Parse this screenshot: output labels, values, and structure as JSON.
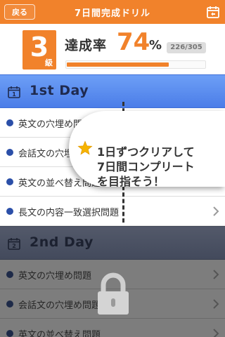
{
  "topbar": {
    "back_label": "戻る",
    "title": "7日間完成ドリル",
    "reset_icon": "calendar-reset-icon"
  },
  "progress": {
    "level_number": "3",
    "level_unit": "級",
    "rate_label": "達成率",
    "rate_value": "74",
    "rate_unit": "%",
    "count": "226/305",
    "fraction": 0.74
  },
  "days": [
    {
      "title": "1st Day",
      "icon_number": "1",
      "locked": false,
      "items": [
        "英文の穴埋め問題",
        "会話文の穴埋め問題",
        "英文の並べ替え問題",
        "長文の内容一致選択問題"
      ]
    },
    {
      "title": "2nd Day",
      "icon_number": "2",
      "locked": true,
      "items": [
        "英文の穴埋め問題",
        "会話文の穴埋め問題",
        "英文の並べ替え問題"
      ]
    }
  ],
  "tooltip": {
    "lines": [
      "1日ずつクリアして",
      "7日間コンプリート",
      "を目指そう！"
    ],
    "icon": "star-icon"
  },
  "colors": {
    "accent": "#f1822b",
    "day_header": "#5b8ef0",
    "locked_header": "#4b5163",
    "bullet": "#2b4fa8"
  }
}
